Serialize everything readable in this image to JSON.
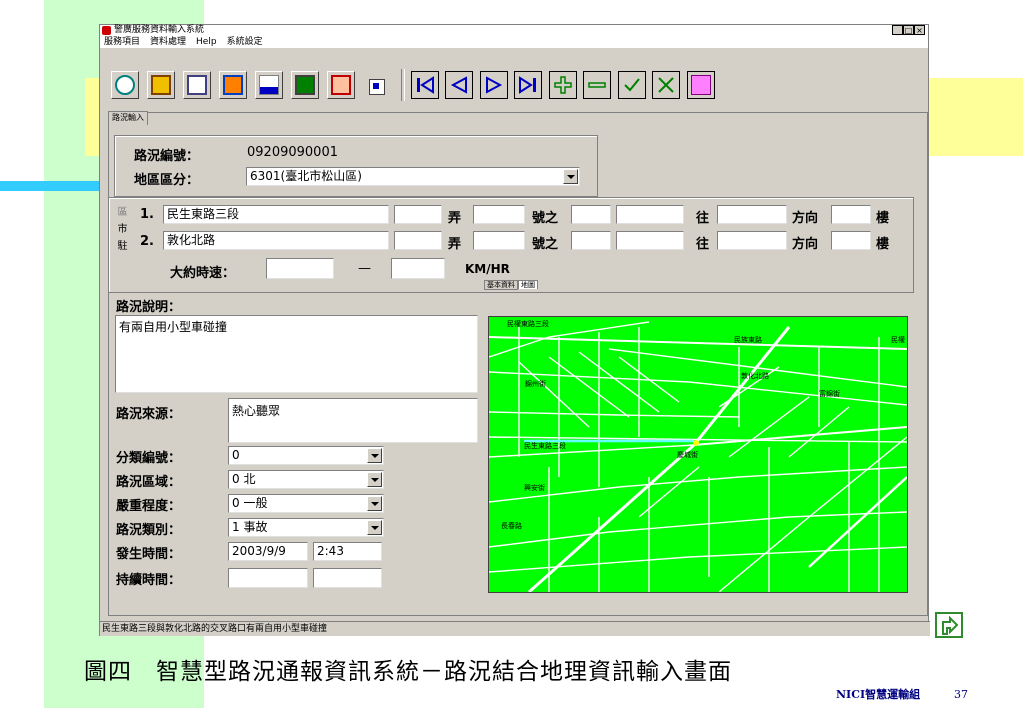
{
  "window": {
    "title": "警廣服務資料輸入系統",
    "menu": [
      "服務項目",
      "資料處理",
      "Help",
      "系統設定"
    ],
    "win_buttons": [
      "_",
      "□",
      "×"
    ]
  },
  "tab": {
    "label": "路況輸入"
  },
  "form": {
    "road_id_label": "路況編號：",
    "road_id_value": "09209090001",
    "district_label": "地區區分：",
    "district_value": "6301(臺北市松山區)",
    "side_buttons": [
      "區",
      "市",
      "駐"
    ],
    "row1_num": "1.",
    "row1_road": "民生東路三段",
    "row2_num": "2.",
    "row2_road": "敦化北路",
    "lane_label": "弄",
    "number_label": "號之",
    "toward_label": "往",
    "direction_label": "方向",
    "floor_label": "樓",
    "speed_label": "大約時速：",
    "speed_dash": "—",
    "speed_unit": "KM/HR",
    "desc_label": "路況說明：",
    "desc_value": "有兩自用小型車碰撞",
    "source_label": "路況來源：",
    "source_value": "熱心聽眾",
    "category_label": "分類編號：",
    "category_value": "0",
    "region_label": "路況區域：",
    "region_value": "0 北",
    "severity_label": "嚴重程度：",
    "severity_value": "0 一般",
    "type_label": "路況類別：",
    "type_value": "1 事故",
    "time_label": "發生時間：",
    "date_value": "2003/9/9",
    "clock_value": "2:43",
    "duration_label": "持續時間："
  },
  "map": {
    "tabs": [
      "基本資料",
      "地圖"
    ],
    "labels": [
      "民權東路三段",
      "民族東路",
      "錦州街",
      "敦化北路",
      "富錦街",
      "民生東路三段",
      "慶城街",
      "興安街",
      "長春路",
      "民權"
    ]
  },
  "statusbar": "民生東路三段與敦化北路的交叉路口有兩自用小型車碰撞",
  "slide": {
    "caption": "圖四　智慧型路況通報資訊系統－路況結合地理資訊輸入畫面",
    "org": "NICI智慧運輸組",
    "page": "37"
  },
  "colors": {
    "map_bg": "#00ff00",
    "window_bg": "#d4d0c8",
    "slide_green": "#ccffcc",
    "slide_yellow": "#ffff99"
  }
}
